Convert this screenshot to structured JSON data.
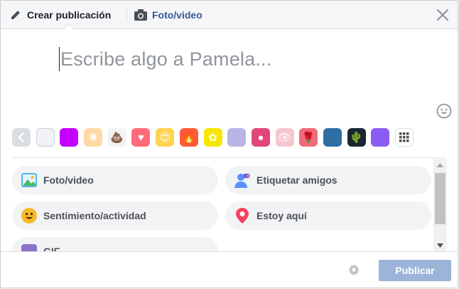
{
  "header": {
    "create_tab": "Crear publicación",
    "photo_tab": "Foto/video"
  },
  "editor": {
    "placeholder": "Escribe algo a Pamela..."
  },
  "swatches": [
    {
      "name": "white",
      "color": "#f0f2f5"
    },
    {
      "name": "purple",
      "color": "#c600ff"
    },
    {
      "name": "leaf",
      "color": "#ffd8a8",
      "glyph": "✺"
    },
    {
      "name": "poop",
      "color": "#f2f3f5",
      "glyph": "💩"
    },
    {
      "name": "heart",
      "color": "#ff6b7a",
      "glyph": "♥"
    },
    {
      "name": "heart-eyes",
      "color": "#ffd34e",
      "glyph": "😍"
    },
    {
      "name": "fire",
      "color": "#ff5a36",
      "glyph": "🔥"
    },
    {
      "name": "yellow-figure",
      "color": "#f7e600",
      "glyph": "✿"
    },
    {
      "name": "lavender",
      "color": "#b9b4e6"
    },
    {
      "name": "orange-fruit",
      "color": "#e0457b",
      "glyph": "●"
    },
    {
      "name": "eye",
      "color": "#f6c6d0",
      "glyph": "👁"
    },
    {
      "name": "rose",
      "color": "#f26b7a",
      "glyph": "🌹"
    },
    {
      "name": "blue-wave",
      "color": "#2f6fa3"
    },
    {
      "name": "cactus",
      "color": "#18272f",
      "glyph": "🌵"
    },
    {
      "name": "violet-rays",
      "color": "#8a5cf5"
    }
  ],
  "actions": [
    {
      "label": "Foto/video",
      "icon": "photo-video-icon"
    },
    {
      "label": "Etiquetar amigos",
      "icon": "tag-friends-icon"
    },
    {
      "label": "Sentimiento/actividad",
      "icon": "feeling-icon"
    },
    {
      "label": "Estoy aquí",
      "icon": "location-pin-icon"
    },
    {
      "label": "GIF",
      "icon": "gif-icon"
    }
  ],
  "footer": {
    "publish_label": "Publicar"
  },
  "colors": {
    "link_blue": "#365899",
    "publish_disabled": "#9cb4d8"
  }
}
